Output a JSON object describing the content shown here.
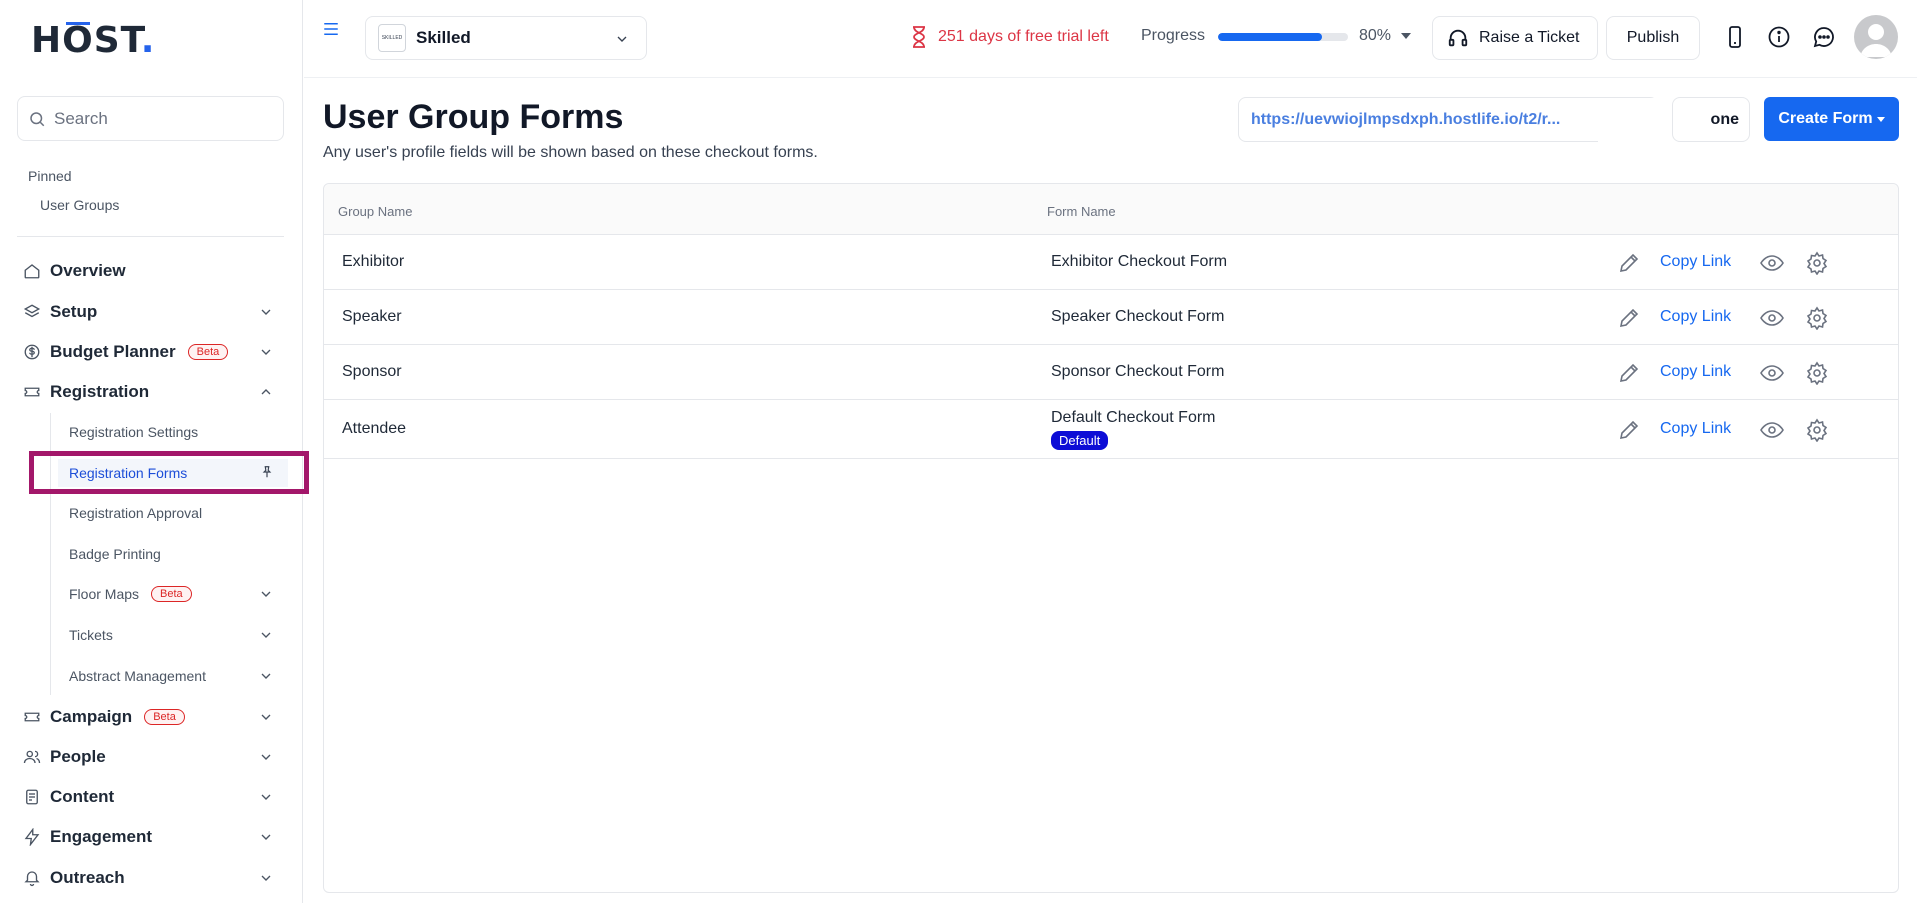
{
  "brand": {
    "logo_text": "HŌST",
    "accent": "#1668f0",
    "danger": "#dc3545"
  },
  "sidebar": {
    "search_placeholder": "Search",
    "pinned_title": "Pinned",
    "pinned_items": [
      "User Groups"
    ],
    "beta_label": "Beta",
    "nav": [
      {
        "label": "Overview",
        "icon": "home-icon"
      },
      {
        "label": "Setup",
        "icon": "layers-icon"
      },
      {
        "label": "Budget Planner",
        "icon": "dollar-icon"
      },
      {
        "label": "Registration",
        "icon": "ticket-icon",
        "expanded": true
      },
      {
        "label": "Campaign",
        "icon": "ticket-icon"
      },
      {
        "label": "People",
        "icon": "people-icon"
      },
      {
        "label": "Content",
        "icon": "document-icon"
      },
      {
        "label": "Engagement",
        "icon": "lightning-icon"
      },
      {
        "label": "Outreach",
        "icon": "bell-icon"
      }
    ],
    "registration_sub": [
      {
        "label": "Registration Settings"
      },
      {
        "label": "Registration Forms",
        "active": true
      },
      {
        "label": "Registration Approval"
      },
      {
        "label": "Badge Printing"
      },
      {
        "label": "Floor Maps"
      },
      {
        "label": "Tickets"
      },
      {
        "label": "Abstract Management"
      }
    ]
  },
  "topbar": {
    "event_name": "Skilled",
    "event_logo_text": "SKILLED",
    "trial_text": "251 days of free trial left",
    "progress_label": "Progress",
    "progress_value": "80%",
    "progress_fraction": 0.8,
    "raise_ticket": "Raise a Ticket",
    "publish": "Publish"
  },
  "main": {
    "title": "User Group Forms",
    "subtitle": "Any user's profile fields will be shown based on these checkout forms.",
    "link_url": "https://uevwiojlmpsdxph.hostlife.io/t2/r...",
    "clone_label_visible": "one",
    "create_form": "Create Form",
    "table": {
      "headers": [
        "Group Name",
        "Form Name"
      ],
      "copy_link_label": "Copy Link",
      "default_badge": "Default",
      "rows": [
        {
          "group": "Exhibitor",
          "form": "Exhibitor Checkout Form"
        },
        {
          "group": "Speaker",
          "form": "Speaker Checkout Form"
        },
        {
          "group": "Sponsor",
          "form": "Sponsor Checkout Form"
        },
        {
          "group": "Attendee",
          "form": "Default Checkout Form"
        }
      ]
    }
  }
}
